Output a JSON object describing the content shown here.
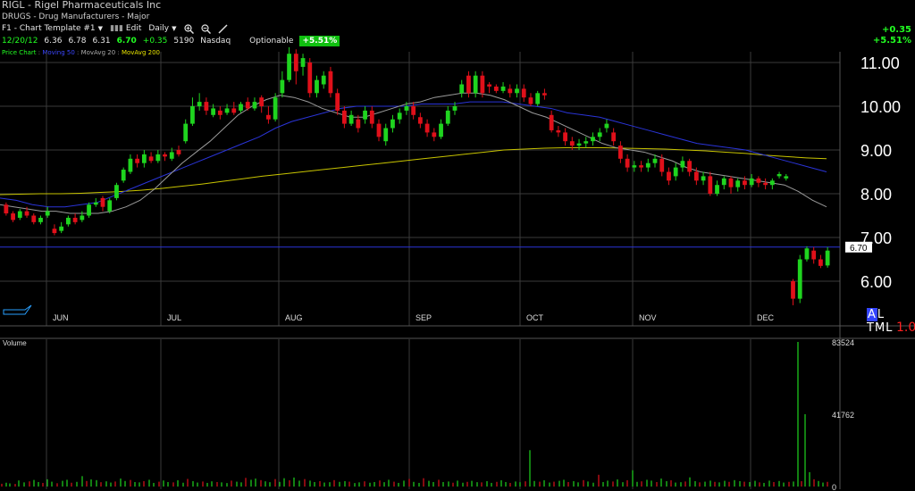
{
  "header": {
    "title": "RIGL - Rigel Pharmaceuticals Inc",
    "sector": "DRUGS - Drug Manufacturers - Major"
  },
  "toolbar": {
    "template_label": "F1 - Chart Template #1",
    "edit_label": "Edit",
    "period_label": "Daily",
    "zoom_in_icon": "zoom-in-icon",
    "zoom_out_icon": "zoom-out-icon",
    "draw_icon": "pencil-icon"
  },
  "quote": {
    "date": "12/20/12",
    "open": "6.36",
    "high": "6.78",
    "low": "6.31",
    "close": "6.70",
    "change": "+0.35",
    "volume": "5190",
    "exchange": "Nasdaq",
    "optionable": "Optionable",
    "pct_badge": "+5.51%"
  },
  "change_box": {
    "change": "+0.35",
    "pct": "+5.51%"
  },
  "indicators": {
    "price": "Price Chart",
    "ma50": "Moving 50",
    "ma20": "MovAvg 20",
    "ma200": "MovAvg 200",
    "sep": " : "
  },
  "colors": {
    "up": "#1fd41f",
    "down": "#e0101a",
    "ma20": "#9a9a9a",
    "ma50": "#2a34d8",
    "ma200": "#c8c400",
    "grid": "#3a3a3a",
    "last_price_line": "#2a34d8"
  },
  "chart_data": {
    "type": "candlestick",
    "price_axis": {
      "ticks": [
        "11.00",
        "10.00",
        "9.00",
        "8.00",
        "7.00",
        "6.00"
      ],
      "ylim": [
        5.3,
        11.9
      ]
    },
    "months": [
      "JUN",
      "JUL",
      "AUG",
      "SEP",
      "OCT",
      "NOV",
      "DEC"
    ],
    "last_price_label": "6.70",
    "last_price": 6.78,
    "candles": [
      [
        7.75,
        7.55,
        7.8,
        7.5
      ],
      [
        7.55,
        7.4,
        7.6,
        7.35
      ],
      [
        7.45,
        7.6,
        7.65,
        7.4
      ],
      [
        7.6,
        7.5,
        7.7,
        7.45
      ],
      [
        7.5,
        7.35,
        7.55,
        7.3
      ],
      [
        7.35,
        7.45,
        7.5,
        7.3
      ],
      [
        7.5,
        7.6,
        7.7,
        7.45
      ],
      [
        7.2,
        7.1,
        7.3,
        7.05
      ],
      [
        7.15,
        7.25,
        7.35,
        7.1
      ],
      [
        7.3,
        7.45,
        7.5,
        7.25
      ],
      [
        7.45,
        7.35,
        7.55,
        7.3
      ],
      [
        7.4,
        7.5,
        7.6,
        7.35
      ],
      [
        7.5,
        7.75,
        7.8,
        7.45
      ],
      [
        7.75,
        7.8,
        7.9,
        7.7
      ],
      [
        7.9,
        7.7,
        7.95,
        7.6
      ],
      [
        7.6,
        7.85,
        7.9,
        7.55
      ],
      [
        7.9,
        8.2,
        8.25,
        7.85
      ],
      [
        8.3,
        8.55,
        8.6,
        8.25
      ],
      [
        8.5,
        8.8,
        8.9,
        8.45
      ],
      [
        8.8,
        8.7,
        8.9,
        8.6
      ],
      [
        8.7,
        8.9,
        9.0,
        8.6
      ],
      [
        8.85,
        8.75,
        8.95,
        8.7
      ],
      [
        8.75,
        8.9,
        9.0,
        8.7
      ],
      [
        8.9,
        8.85,
        8.95,
        8.75
      ],
      [
        8.8,
        8.95,
        9.05,
        8.75
      ],
      [
        9.0,
        8.9,
        9.1,
        8.85
      ],
      [
        9.2,
        9.6,
        9.7,
        9.15
      ],
      [
        9.6,
        10.0,
        10.2,
        9.55
      ],
      [
        10.0,
        10.1,
        10.3,
        9.9
      ],
      [
        10.1,
        9.9,
        10.2,
        9.8
      ],
      [
        9.8,
        9.95,
        10.05,
        9.75
      ],
      [
        9.9,
        9.8,
        10.0,
        9.7
      ],
      [
        9.85,
        9.95,
        10.05,
        9.8
      ],
      [
        9.95,
        9.85,
        10.1,
        9.8
      ],
      [
        9.9,
        10.05,
        10.1,
        9.85
      ],
      [
        10.1,
        9.95,
        10.2,
        9.9
      ],
      [
        9.95,
        10.1,
        10.2,
        9.9
      ],
      [
        10.2,
        10.0,
        10.25,
        9.85
      ],
      [
        9.8,
        9.7,
        10.0,
        9.6
      ],
      [
        9.7,
        10.2,
        10.3,
        9.65
      ],
      [
        10.3,
        10.6,
        10.8,
        10.2
      ],
      [
        10.6,
        11.2,
        11.35,
        10.55
      ],
      [
        11.2,
        10.8,
        11.3,
        10.5
      ],
      [
        10.9,
        11.1,
        11.2,
        10.7
      ],
      [
        11.0,
        10.3,
        11.1,
        10.2
      ],
      [
        10.3,
        10.6,
        10.7,
        10.2
      ],
      [
        10.5,
        10.7,
        10.8,
        10.4
      ],
      [
        10.8,
        10.3,
        10.9,
        10.2
      ],
      [
        10.3,
        9.9,
        10.4,
        9.8
      ],
      [
        9.9,
        9.6,
        10.0,
        9.5
      ],
      [
        9.6,
        9.8,
        9.9,
        9.55
      ],
      [
        9.7,
        9.5,
        9.8,
        9.4
      ],
      [
        9.7,
        9.9,
        10.0,
        9.6
      ],
      [
        9.9,
        9.6,
        10.0,
        9.5
      ],
      [
        9.6,
        9.3,
        9.7,
        9.2
      ],
      [
        9.2,
        9.5,
        9.6,
        9.1
      ],
      [
        9.5,
        9.7,
        9.8,
        9.4
      ],
      [
        9.7,
        9.85,
        9.95,
        9.6
      ],
      [
        9.9,
        10.0,
        10.1,
        9.8
      ],
      [
        10.0,
        9.8,
        10.1,
        9.7
      ],
      [
        9.75,
        9.6,
        9.85,
        9.5
      ],
      [
        9.6,
        9.4,
        9.7,
        9.3
      ],
      [
        9.4,
        9.3,
        9.5,
        9.2
      ],
      [
        9.3,
        9.6,
        9.7,
        9.25
      ],
      [
        9.6,
        9.9,
        10.0,
        9.55
      ],
      [
        9.9,
        10.0,
        10.1,
        9.8
      ],
      [
        10.3,
        10.5,
        10.6,
        10.2
      ],
      [
        10.7,
        10.3,
        10.8,
        10.2
      ],
      [
        10.3,
        10.7,
        10.8,
        10.2
      ],
      [
        10.7,
        10.3,
        10.8,
        10.2
      ],
      [
        10.5,
        10.45,
        10.55,
        10.3
      ],
      [
        10.45,
        10.35,
        10.5,
        10.3
      ],
      [
        10.35,
        10.45,
        10.55,
        10.3
      ],
      [
        10.4,
        10.3,
        10.5,
        10.2
      ],
      [
        10.3,
        10.4,
        10.5,
        10.2
      ],
      [
        10.4,
        10.2,
        10.5,
        10.1
      ],
      [
        10.2,
        10.05,
        10.3,
        10.0
      ],
      [
        10.05,
        10.3,
        10.35,
        10.0
      ],
      [
        10.3,
        10.25,
        10.4,
        10.15
      ],
      [
        9.8,
        9.45,
        9.9,
        9.4
      ],
      [
        9.45,
        9.4,
        9.55,
        9.3
      ],
      [
        9.4,
        9.2,
        9.5,
        9.1
      ],
      [
        9.2,
        9.1,
        9.3,
        9.0
      ],
      [
        9.1,
        9.15,
        9.25,
        9.0
      ],
      [
        9.15,
        9.2,
        9.3,
        9.05
      ],
      [
        9.2,
        9.3,
        9.4,
        9.1
      ],
      [
        9.3,
        9.4,
        9.5,
        9.2
      ],
      [
        9.5,
        9.6,
        9.7,
        9.4
      ],
      [
        9.4,
        9.2,
        9.5,
        9.1
      ],
      [
        9.1,
        8.8,
        9.2,
        8.7
      ],
      [
        8.8,
        8.6,
        8.9,
        8.5
      ],
      [
        8.6,
        8.65,
        8.75,
        8.5
      ],
      [
        8.65,
        8.6,
        8.75,
        8.5
      ],
      [
        8.6,
        8.7,
        8.8,
        8.5
      ],
      [
        8.7,
        8.8,
        8.9,
        8.6
      ],
      [
        8.8,
        8.5,
        8.9,
        8.4
      ],
      [
        8.5,
        8.3,
        8.6,
        8.2
      ],
      [
        8.4,
        8.6,
        8.7,
        8.3
      ],
      [
        8.6,
        8.75,
        8.85,
        8.5
      ],
      [
        8.75,
        8.5,
        8.8,
        8.4
      ],
      [
        8.5,
        8.3,
        8.6,
        8.2
      ],
      [
        8.3,
        8.4,
        8.5,
        8.2
      ],
      [
        8.4,
        8.0,
        8.5,
        7.95
      ],
      [
        8.0,
        8.2,
        8.3,
        7.95
      ],
      [
        8.2,
        8.35,
        8.4,
        8.1
      ],
      [
        8.35,
        8.15,
        8.4,
        8.0
      ],
      [
        8.15,
        8.3,
        8.35,
        8.05
      ],
      [
        8.3,
        8.2,
        8.4,
        8.1
      ],
      [
        8.2,
        8.35,
        8.45,
        8.15
      ],
      [
        8.35,
        8.25,
        8.4,
        8.15
      ],
      [
        8.25,
        8.2,
        8.35,
        8.1
      ],
      [
        8.2,
        8.3,
        8.35,
        8.1
      ],
      [
        8.4,
        8.45,
        8.5,
        8.35
      ],
      [
        8.35,
        8.4,
        8.45,
        8.3
      ],
      [
        6.0,
        5.6,
        6.05,
        5.45
      ],
      [
        5.6,
        6.5,
        6.6,
        5.5
      ],
      [
        6.5,
        6.75,
        6.8,
        6.45
      ],
      [
        6.7,
        6.5,
        6.78,
        6.4
      ],
      [
        6.5,
        6.35,
        6.6,
        6.3
      ],
      [
        6.36,
        6.7,
        6.78,
        6.31
      ]
    ],
    "ma20": [
      7.75,
      7.7,
      7.65,
      7.6,
      7.6,
      7.55,
      7.55,
      7.55,
      7.6,
      7.7,
      7.85,
      8.1,
      8.4,
      8.7,
      8.95,
      9.2,
      9.5,
      9.8,
      10.0,
      10.15,
      10.25,
      10.2,
      10.1,
      9.95,
      9.85,
      9.75,
      9.75,
      9.85,
      9.95,
      10.05,
      10.1,
      10.2,
      10.25,
      10.3,
      10.3,
      10.25,
      10.15,
      10.0,
      9.85,
      9.75,
      9.6,
      9.45,
      9.3,
      9.15,
      9.05,
      9.0,
      8.95,
      8.85,
      8.75,
      8.6,
      8.5,
      8.45,
      8.4,
      8.35,
      8.3,
      8.25,
      8.2,
      8.05,
      7.85,
      7.7
    ],
    "ma50": [
      7.9,
      7.85,
      7.75,
      7.7,
      7.7,
      7.75,
      7.8,
      7.95,
      8.1,
      8.25,
      8.4,
      8.55,
      8.7,
      8.85,
      9.0,
      9.15,
      9.3,
      9.5,
      9.65,
      9.75,
      9.85,
      9.95,
      10.0,
      10.0,
      10.0,
      10.0,
      10.05,
      10.05,
      10.05,
      10.1,
      10.1,
      10.1,
      10.05,
      10.0,
      9.95,
      9.85,
      9.8,
      9.75,
      9.65,
      9.55,
      9.45,
      9.35,
      9.25,
      9.15,
      9.1,
      9.05,
      9.0,
      8.9,
      8.8,
      8.7,
      8.6,
      8.5
    ],
    "ma200": [
      7.98,
      7.99,
      8.0,
      8.0,
      8.01,
      8.03,
      8.05,
      8.08,
      8.12,
      8.17,
      8.22,
      8.28,
      8.34,
      8.4,
      8.45,
      8.5,
      8.55,
      8.6,
      8.65,
      8.7,
      8.75,
      8.8,
      8.85,
      8.9,
      8.95,
      9.0,
      9.02,
      9.04,
      9.05,
      9.05,
      9.05,
      9.04,
      9.03,
      9.02,
      9.0,
      8.98,
      8.95,
      8.92,
      8.88,
      8.85,
      8.82,
      8.8
    ],
    "volume_axis": {
      "ticks": [
        "83524",
        "41762",
        "0"
      ],
      "max": 83524
    },
    "volume_label": "Volume",
    "volumes": [
      [
        2,
        1600
      ],
      [
        7,
        2200
      ],
      [
        11,
        1800
      ],
      [
        17,
        1500
      ],
      [
        21,
        3500
      ],
      [
        27,
        2400
      ],
      [
        33,
        3000
      ],
      [
        38,
        3800
      ],
      [
        43,
        2600
      ],
      [
        48,
        2100
      ],
      [
        53,
        4200
      ],
      [
        58,
        2800
      ],
      [
        64,
        1900
      ],
      [
        70,
        3300
      ],
      [
        75,
        3900
      ],
      [
        80,
        2200
      ],
      [
        86,
        2700
      ],
      [
        92,
        6000
      ],
      [
        97,
        3200
      ],
      [
        102,
        4100
      ],
      [
        108,
        3700
      ],
      [
        113,
        2500
      ],
      [
        119,
        3000
      ],
      [
        124,
        2300
      ],
      [
        129,
        2900
      ],
      [
        135,
        4600
      ],
      [
        140,
        3200
      ],
      [
        146,
        3800
      ],
      [
        151,
        2600
      ],
      [
        156,
        2400
      ],
      [
        161,
        3100
      ],
      [
        167,
        3900
      ],
      [
        172,
        2100
      ],
      [
        178,
        2800
      ],
      [
        183,
        3500
      ],
      [
        188,
        2600
      ],
      [
        194,
        2400
      ],
      [
        199,
        3600
      ],
      [
        205,
        2200
      ],
      [
        210,
        4400
      ],
      [
        216,
        3100
      ],
      [
        221,
        2300
      ],
      [
        227,
        2900
      ],
      [
        232,
        2100
      ],
      [
        237,
        3000
      ],
      [
        243,
        2600
      ],
      [
        248,
        2400
      ],
      [
        254,
        2000
      ],
      [
        259,
        3400
      ],
      [
        265,
        2800
      ],
      [
        270,
        2400
      ],
      [
        275,
        5000
      ],
      [
        281,
        3900
      ],
      [
        286,
        4600
      ],
      [
        292,
        3700
      ],
      [
        297,
        3000
      ],
      [
        302,
        2500
      ],
      [
        308,
        4300
      ],
      [
        313,
        2700
      ],
      [
        318,
        4800
      ],
      [
        324,
        3600
      ],
      [
        329,
        5200
      ],
      [
        335,
        3400
      ],
      [
        341,
        4300
      ],
      [
        347,
        3400
      ],
      [
        352,
        2600
      ],
      [
        358,
        3100
      ],
      [
        363,
        2300
      ],
      [
        369,
        2500
      ],
      [
        374,
        3700
      ],
      [
        380,
        2700
      ],
      [
        386,
        3100
      ],
      [
        391,
        2800
      ],
      [
        397,
        2000
      ],
      [
        402,
        2400
      ],
      [
        408,
        3000
      ],
      [
        414,
        2200
      ],
      [
        419,
        2600
      ],
      [
        425,
        3500
      ],
      [
        430,
        2500
      ],
      [
        435,
        3900
      ],
      [
        441,
        2800
      ],
      [
        446,
        2100
      ],
      [
        452,
        3400
      ],
      [
        458,
        4400
      ],
      [
        463,
        2700
      ],
      [
        469,
        2100
      ],
      [
        474,
        4800
      ],
      [
        480,
        3300
      ],
      [
        485,
        2600
      ],
      [
        491,
        3900
      ],
      [
        496,
        2600
      ],
      [
        502,
        2900
      ],
      [
        507,
        2200
      ],
      [
        512,
        3400
      ],
      [
        518,
        2200
      ],
      [
        523,
        2700
      ],
      [
        528,
        3300
      ],
      [
        534,
        2500
      ],
      [
        539,
        2400
      ],
      [
        545,
        3100
      ],
      [
        550,
        2100
      ],
      [
        556,
        2700
      ],
      [
        561,
        3600
      ],
      [
        566,
        2600
      ],
      [
        571,
        2100
      ],
      [
        577,
        2900
      ],
      [
        582,
        2500
      ],
      [
        588,
        3000
      ],
      [
        593,
        21000
      ],
      [
        598,
        3200
      ],
      [
        604,
        2800
      ],
      [
        609,
        3600
      ],
      [
        615,
        2300
      ],
      [
        620,
        2800
      ],
      [
        626,
        3300
      ],
      [
        631,
        3900
      ],
      [
        636,
        2600
      ],
      [
        642,
        3100
      ],
      [
        647,
        2400
      ],
      [
        653,
        3700
      ],
      [
        658,
        2900
      ],
      [
        664,
        2200
      ],
      [
        670,
        6800
      ],
      [
        675,
        2600
      ],
      [
        680,
        3400
      ],
      [
        686,
        2900
      ],
      [
        691,
        4100
      ],
      [
        697,
        2500
      ],
      [
        702,
        3600
      ],
      [
        708,
        9400
      ],
      [
        713,
        2700
      ],
      [
        718,
        3000
      ],
      [
        724,
        3900
      ],
      [
        729,
        3400
      ],
      [
        735,
        2600
      ],
      [
        740,
        4600
      ],
      [
        746,
        3100
      ],
      [
        751,
        3600
      ],
      [
        756,
        2300
      ],
      [
        762,
        2500
      ],
      [
        767,
        2900
      ],
      [
        772,
        5300
      ],
      [
        778,
        3100
      ],
      [
        783,
        2400
      ],
      [
        789,
        2800
      ],
      [
        795,
        3400
      ],
      [
        800,
        2700
      ],
      [
        805,
        2400
      ],
      [
        811,
        3300
      ],
      [
        816,
        2700
      ],
      [
        822,
        3700
      ],
      [
        828,
        3100
      ],
      [
        833,
        2800
      ],
      [
        839,
        2600
      ],
      [
        845,
        3300
      ],
      [
        850,
        2400
      ],
      [
        855,
        2100
      ],
      [
        861,
        3400
      ],
      [
        866,
        2600
      ],
      [
        872,
        3200
      ],
      [
        877,
        2300
      ],
      [
        883,
        2700
      ],
      [
        888,
        2900
      ],
      [
        893,
        83524
      ],
      [
        897,
        3100
      ],
      [
        901,
        41762
      ],
      [
        906,
        8300
      ],
      [
        911,
        4200
      ],
      [
        916,
        3200
      ],
      [
        921,
        2300
      ],
      [
        926,
        2700
      ]
    ]
  }
}
